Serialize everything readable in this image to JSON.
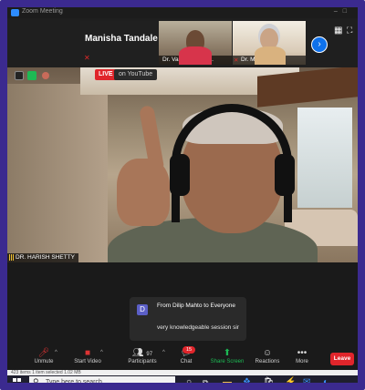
{
  "window": {
    "title": "Zoom Meeting"
  },
  "participants_strip": {
    "active_speaker_name": "Manisha Tandale",
    "tiles": [
      {
        "label": "Dr. Vaishali Sawa..."
      },
      {
        "label": "Dr. Manjeet S..."
      }
    ]
  },
  "main_video": {
    "live_badge": "LIVE",
    "live_destination": "on YouTube",
    "speaker_label": "DR. HARISH SHETTY"
  },
  "chat_popup": {
    "avatar_letter": "D",
    "from": "From Dilip Mahto to Everyone",
    "message": "very knowledgeable session sir"
  },
  "toolbar": {
    "unmute": "Unmute",
    "start_video": "Start Video",
    "participants": "Participants",
    "participants_count": "97",
    "chat": "Chat",
    "chat_badge": "15",
    "share_screen": "Share Screen",
    "reactions": "Reactions",
    "more": "More",
    "leave": "Leave"
  },
  "explorer_status": {
    "text": "423 items    1 item selected  1.02 MB"
  },
  "taskbar": {
    "search_placeholder": "Type here to search"
  },
  "colors": {
    "frame": "#3b2a8f",
    "live": "#e0252b",
    "share": "#1db954",
    "leave": "#e0252b",
    "accent_blue": "#0e71eb"
  }
}
